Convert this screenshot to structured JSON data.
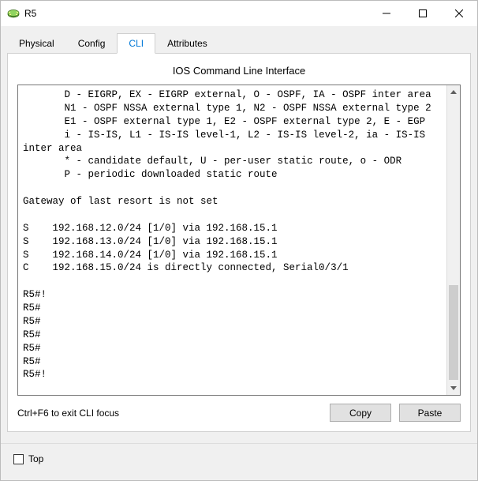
{
  "window": {
    "title": "R5"
  },
  "tabs": {
    "t0": "Physical",
    "t1": "Config",
    "t2": "CLI",
    "t3": "Attributes"
  },
  "cli": {
    "heading": "IOS Command Line Interface",
    "output": "       D - EIGRP, EX - EIGRP external, O - OSPF, IA - OSPF inter area\n       N1 - OSPF NSSA external type 1, N2 - OSPF NSSA external type 2\n       E1 - OSPF external type 1, E2 - OSPF external type 2, E - EGP\n       i - IS-IS, L1 - IS-IS level-1, L2 - IS-IS level-2, ia - IS-IS inter area\n       * - candidate default, U - per-user static route, o - ODR\n       P - periodic downloaded static route\n\nGateway of last resort is not set\n\nS    192.168.12.0/24 [1/0] via 192.168.15.1\nS    192.168.13.0/24 [1/0] via 192.168.15.1\nS    192.168.14.0/24 [1/0] via 192.168.15.1\nC    192.168.15.0/24 is directly connected, Serial0/3/1\n\nR5#!\nR5#\nR5#\nR5#\nR5#\nR5#\nR5#!"
  },
  "buttons": {
    "copy": "Copy",
    "paste": "Paste"
  },
  "hint": "Ctrl+F6 to exit CLI focus",
  "footer": {
    "top_label": "Top"
  }
}
